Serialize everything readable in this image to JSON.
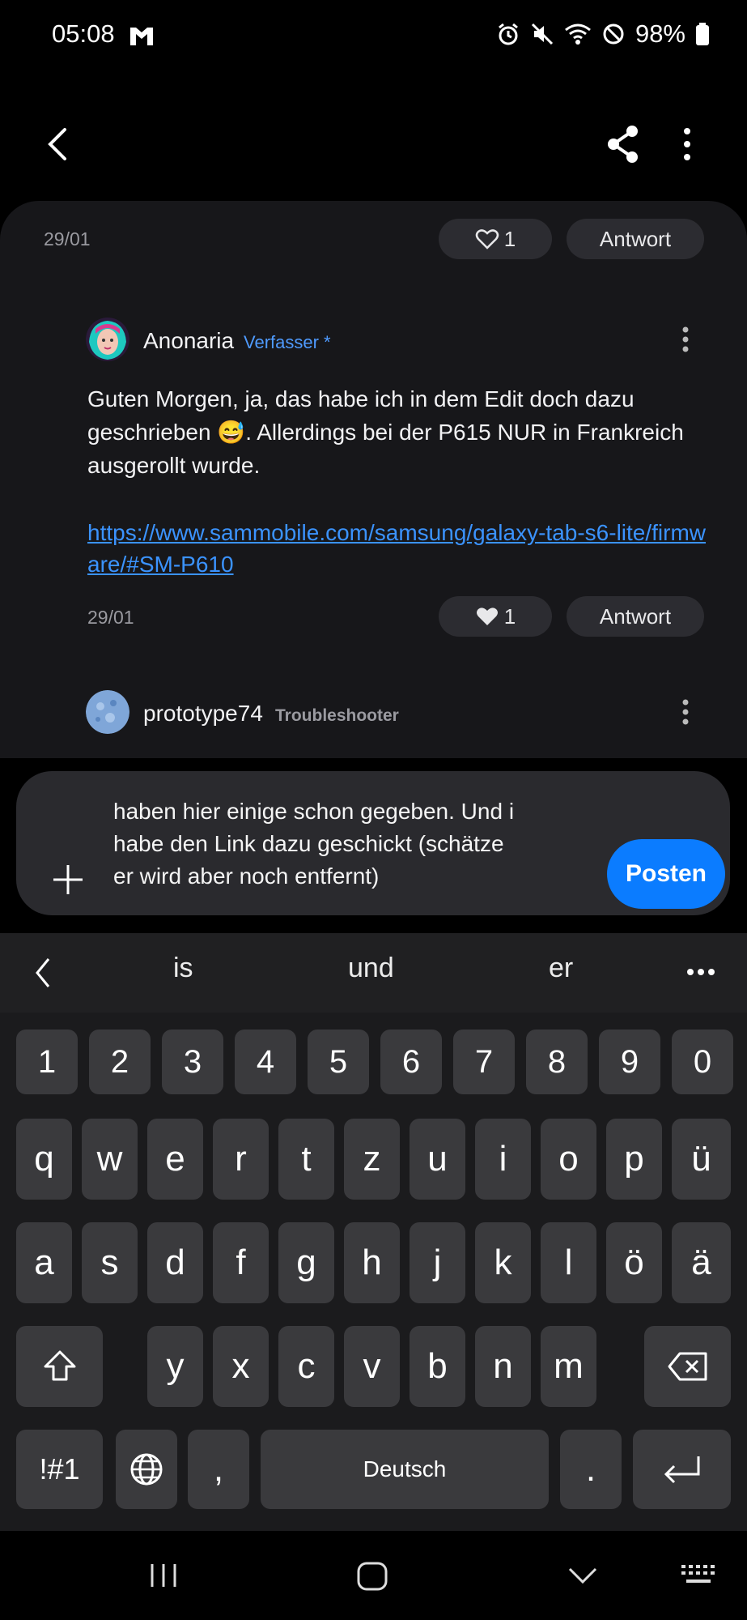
{
  "status_bar": {
    "time": "05:08",
    "battery": "98%"
  },
  "post1": {
    "date": "29/01",
    "likes": "1",
    "reply_label": "Antwort"
  },
  "post2": {
    "author": "Anonaria",
    "role": "Verfasser *",
    "text": "Guten Morgen, ja, das habe ich in dem Edit doch dazu geschrieben 😅. Allerdings bei der P615 NUR in Frankreich ausgerollt wurde.",
    "link": "https://www.sammobile.com/samsung/galaxy-tab-s6-lite/firmware/#SM-P610",
    "date": "29/01",
    "likes": "1",
    "reply_label": "Antwort"
  },
  "post3": {
    "author": "prototype74",
    "role": "Troubleshooter"
  },
  "composer": {
    "text_lines": [
      "haben hier einige schon gegeben. Und i",
      "habe den Link dazu geschickt (schätze",
      "er wird aber noch entfernt)"
    ],
    "post_label": "Posten"
  },
  "keyboard": {
    "suggestions": [
      "is",
      "und",
      "er"
    ],
    "row_numbers": [
      "1",
      "2",
      "3",
      "4",
      "5",
      "6",
      "7",
      "8",
      "9",
      "0"
    ],
    "row1": [
      "q",
      "w",
      "e",
      "r",
      "t",
      "z",
      "u",
      "i",
      "o",
      "p",
      "ü"
    ],
    "row2": [
      "a",
      "s",
      "d",
      "f",
      "g",
      "h",
      "j",
      "k",
      "l",
      "ö",
      "ä"
    ],
    "row3": [
      "y",
      "x",
      "c",
      "v",
      "b",
      "n",
      "m"
    ],
    "symbols_label": "!#1",
    "comma": ",",
    "space_label": "Deutsch",
    "period": "."
  }
}
